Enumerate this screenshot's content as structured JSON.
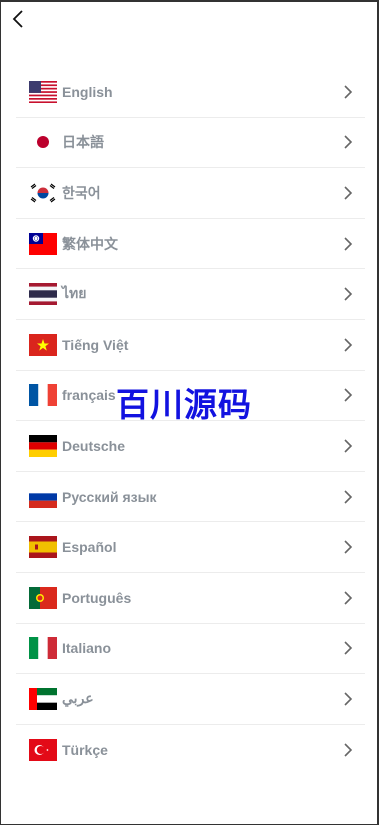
{
  "languages": [
    {
      "label": "English",
      "flag": "us-flag-icon"
    },
    {
      "label": "日本語",
      "flag": "japan-flag-icon"
    },
    {
      "label": "한국어",
      "flag": "korea-flag-icon"
    },
    {
      "label": "繁体中文",
      "flag": "taiwan-flag-icon"
    },
    {
      "label": "ไทย",
      "flag": "thailand-flag-icon"
    },
    {
      "label": "Tiếng Việt",
      "flag": "vietnam-flag-icon"
    },
    {
      "label": "français",
      "flag": "france-flag-icon"
    },
    {
      "label": "Deutsche",
      "flag": "germany-flag-icon"
    },
    {
      "label": "Русский язык",
      "flag": "russia-flag-icon"
    },
    {
      "label": "Español",
      "flag": "spain-flag-icon"
    },
    {
      "label": "Português",
      "flag": "portugal-flag-icon"
    },
    {
      "label": "Italiano",
      "flag": "italy-flag-icon"
    },
    {
      "label": "عربي",
      "flag": "uae-flag-icon"
    },
    {
      "label": "Türkçe",
      "flag": "turkey-flag-icon"
    }
  ],
  "watermark": "百川源码",
  "colors": {
    "label": "#8a9199",
    "chevron": "#666666",
    "watermark": "#1212e0"
  }
}
